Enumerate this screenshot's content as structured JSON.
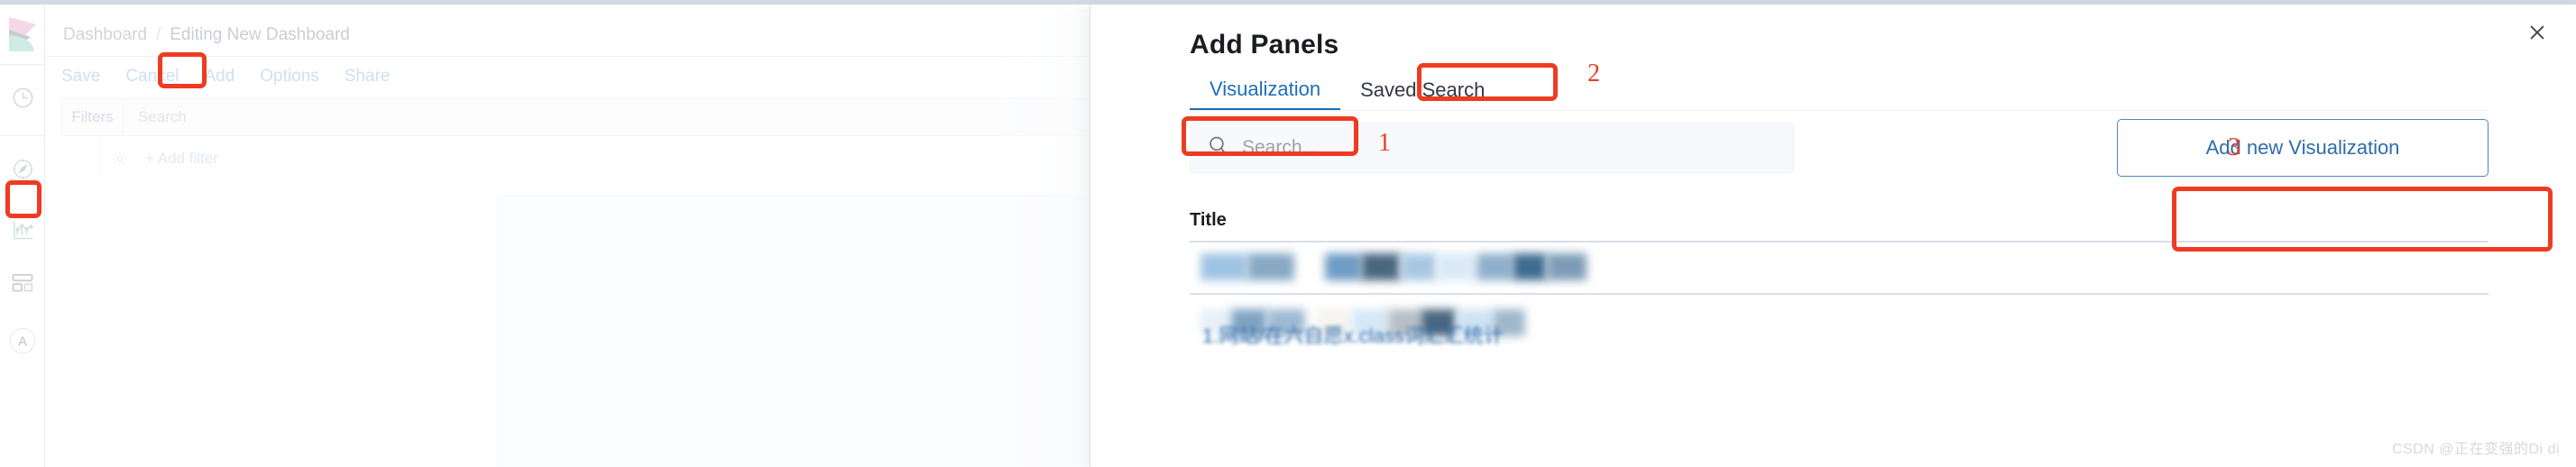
{
  "window": {
    "background_color": "#ffffff",
    "accent_blue": "#1d6fb8",
    "annotation_red": "#ef3b22"
  },
  "sidebar": {
    "logo_name": "kibana-logo",
    "items": [
      {
        "icon": "clock-icon",
        "name": "recently-viewed",
        "label": ""
      },
      {
        "icon": "compass-icon",
        "name": "discover",
        "label": ""
      },
      {
        "icon": "chart-icon",
        "name": "visualize",
        "label": ""
      },
      {
        "icon": "dashboard-icon",
        "name": "dashboard",
        "label": "",
        "selected": true
      },
      {
        "icon": "letter-a-icon",
        "name": "avatar",
        "label": "A"
      }
    ]
  },
  "background": {
    "breadcrumbs": {
      "root": "Dashboard",
      "separator": "/",
      "current": "Editing New Dashboard"
    },
    "actions": [
      {
        "label": "Save",
        "name": "save"
      },
      {
        "label": "Cancel",
        "name": "cancel"
      },
      {
        "label": "Add",
        "name": "add"
      },
      {
        "label": "Options",
        "name": "options"
      },
      {
        "label": "Share",
        "name": "share"
      }
    ],
    "query_bar": {
      "filters_label": "Filters",
      "search_placeholder": "Search"
    },
    "filter_row": {
      "gear_icon": "gear-icon",
      "add_filter_label": "+ Add filter"
    }
  },
  "flyout": {
    "title": "Add Panels",
    "close_icon": "close-icon",
    "tabs": [
      {
        "label": "Visualization",
        "name": "tab-visualization",
        "active": true
      },
      {
        "label": "Saved Search",
        "name": "tab-saved-search",
        "active": false
      }
    ],
    "search": {
      "placeholder": "Search...",
      "value": "",
      "icon": "search-icon"
    },
    "add_new_button": {
      "label": "Add new Visualization"
    },
    "list": {
      "column_header": "Title",
      "rows": [
        {
          "text": "",
          "redacted": true
        },
        {
          "text": "1.网站/在六自愿x.class词汇汇统计",
          "redacted": true
        }
      ]
    }
  },
  "annotations": [
    {
      "number": "1",
      "target": "search-input"
    },
    {
      "number": "2",
      "target": "tab-saved-search"
    },
    {
      "number": "3",
      "target": "add-new-visualization-button"
    }
  ],
  "watermark": "CSDN @正在变强的Di di"
}
